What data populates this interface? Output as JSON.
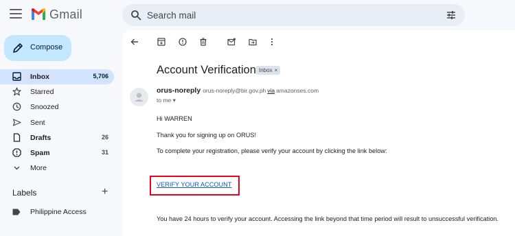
{
  "app": {
    "brand": "Gmail"
  },
  "search": {
    "placeholder": "Search mail"
  },
  "compose": {
    "label": "Compose"
  },
  "nav": [
    {
      "label": "Inbox",
      "count": "5,706",
      "icon": "inbox-icon"
    },
    {
      "label": "Starred",
      "count": "",
      "icon": "star-icon"
    },
    {
      "label": "Snoozed",
      "count": "",
      "icon": "clock-icon"
    },
    {
      "label": "Sent",
      "count": "",
      "icon": "send-icon"
    },
    {
      "label": "Drafts",
      "count": "26",
      "icon": "draft-icon"
    },
    {
      "label": "Spam",
      "count": "31",
      "icon": "spam-icon"
    },
    {
      "label": "More",
      "count": "",
      "icon": "chevron-down-icon"
    }
  ],
  "labels": {
    "heading": "Labels",
    "add": "+",
    "items": [
      {
        "label": "Philippine Access"
      }
    ]
  },
  "email": {
    "subject": "Account Verification",
    "badge": "Inbox",
    "badge_close": "×",
    "sender_name": "orus-noreply",
    "sender_email": "orus-noreply@bir.gov.ph",
    "via": "via",
    "via_domain": "amazonses.com",
    "to": "to me",
    "greeting": "Hi WARREN",
    "thanks": "Thank you for signing up on ORUS!",
    "instruction": "To complete your registration, please verify your account by clicking the link below:",
    "link_text": "VERIFY YOUR ACCOUNT",
    "footer": "You have 24 hours to verify your account. Accessing the link beyond that time period will result to unsuccessful verification."
  },
  "colors": {
    "accent_compose": "#c2e7ff",
    "nav_active": "#d3e3fd",
    "highlight_box": "#e8001c",
    "link": "#1155cc"
  }
}
